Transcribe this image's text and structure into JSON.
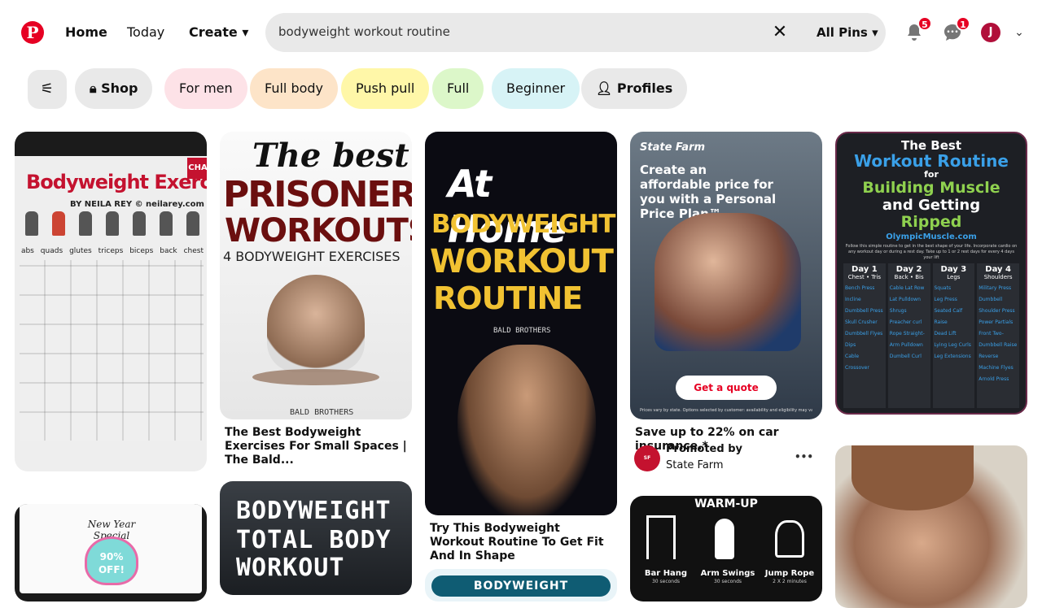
{
  "header": {
    "logo": "P",
    "nav": {
      "home": "Home",
      "today": "Today",
      "create": "Create ▾"
    },
    "search": {
      "query": "bodyweight workout routine",
      "clear": "✕",
      "filter": "All Pins ▾"
    },
    "notifications_count": "5",
    "messages_count": "1",
    "avatar_initial": "J",
    "menu_chevron": "⌄"
  },
  "filters": {
    "toggle_icon": "⚟",
    "chips": [
      {
        "label": "Shop",
        "bg": "#e9e9e9"
      },
      {
        "label": "For men",
        "bg": "#fde2e7"
      },
      {
        "label": "Full body",
        "bg": "#fde4c8"
      },
      {
        "label": "Push pull",
        "bg": "#fff7a8"
      },
      {
        "label": "Full",
        "bg": "#dcf7c9"
      },
      {
        "label": "Beginner",
        "bg": "#d7f3f6"
      },
      {
        "label": "Profiles",
        "bg": "#e9e9e9"
      }
    ]
  },
  "pins": {
    "p1": {
      "title": "Bodyweight Exercises",
      "byline": "BY NEILA REY © neilarey.com",
      "corner_tag": "CHA",
      "muscles": [
        "abs",
        "quads",
        "glutes",
        "triceps",
        "biceps",
        "back",
        "chest"
      ]
    },
    "p2": {
      "line1": "The best",
      "line2": "PRISONER",
      "line3": "WORKOUTS",
      "line4": "4 BODYWEIGHT EXERCISES",
      "brand": "BALD BROTHERS",
      "caption": "The Best Bodyweight Exercises For Small Spaces | The Bald..."
    },
    "p3": {
      "line1": "At Home",
      "line2": "BODYWEIGHT",
      "line3": "WORKOUT",
      "line4": "ROUTINE",
      "brand": "BALD BROTHERS",
      "caption": "Try This Bodyweight Workout Routine To Get Fit And In Shape"
    },
    "p4": {
      "brand": "State Farm",
      "headline": "Create an affordable price for you with a Personal Price Plan™.",
      "cta": "Get a quote",
      "fineprint": "Prices vary by state. Options selected by customer: availability and eligibility may vary.",
      "caption": "Save up to 22% on car insurance.*",
      "promoted": "Promoted by",
      "advertiser": "State Farm",
      "more": "•••"
    },
    "p5": {
      "title1": "The Best",
      "title2": "Workout Routine",
      "title3": "for",
      "title4": "Building Muscle",
      "title5": "and Getting",
      "title6": "Ripped",
      "site": "OlympicMuscle.com",
      "intro": "Follow this simple routine to get in the best shape of your life. Incorporate cardio on any workout day or during a rest day. Take up to 1 or 2 rest days for every 4 days your lift",
      "days": [
        {
          "name": "Day 1",
          "focus": "Chest • Tris",
          "items": [
            "Bench Press",
            "Incline Dumbbell Press",
            "Skull Crusher",
            "Dumbbell Flyes",
            "Dips",
            "Cable Crossover"
          ]
        },
        {
          "name": "Day 2",
          "focus": "Back • Bis",
          "items": [
            "Cable Lat Row",
            "Lat Pulldown",
            "Shrugs",
            "Preacher curl",
            "Rope Straight-Arm Pulldown",
            "Dumbell Curl"
          ]
        },
        {
          "name": "Day 3",
          "focus": "Legs",
          "items": [
            "Squats",
            "Leg Press",
            "Seated Calf Raise",
            "Dead Lift",
            "Lying Leg Curls",
            "Leg Extensions"
          ]
        },
        {
          "name": "Day 4",
          "focus": "Shoulders",
          "items": [
            "Military Press",
            "Dumbbell Shoulder Press",
            "Power Partials",
            "Front Two-Dumbbell Raise",
            "Reverse Machine Flyes",
            "Arnold Press"
          ]
        }
      ]
    },
    "p6": {
      "banner": "New Year Special",
      "offer": "90% OFF!"
    },
    "p7": {
      "line1": "BODYWEIGHT",
      "line2": "TOTAL BODY",
      "line3": "WORKOUT"
    },
    "p8": {
      "headline": "BODYWEIGHT WORKOUTS"
    },
    "p9": {
      "title": "WARM-UP",
      "items": [
        {
          "label": "Bar Hang",
          "sub": "30 seconds"
        },
        {
          "label": "Arm Swings",
          "sub": "30 seconds"
        },
        {
          "label": "Jump Rope",
          "sub": "2 X 2 minutes"
        }
      ]
    }
  },
  "colors": {
    "brand": "#e60023",
    "prisoner_red": "#6b0f0f",
    "gold": "#f1c232",
    "blue_title": "#3aa0e8",
    "green_title": "#8fd14f"
  }
}
